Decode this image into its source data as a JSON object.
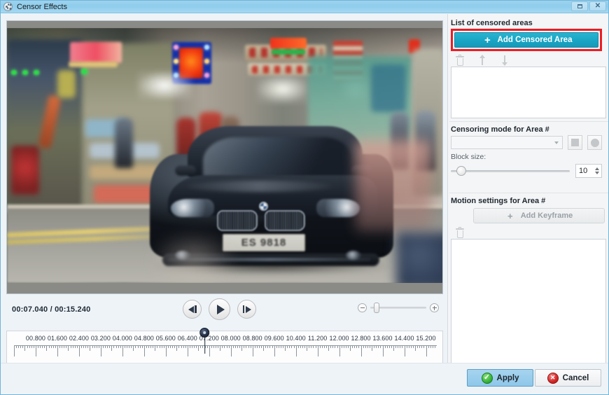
{
  "window": {
    "title": "Censor Effects",
    "icon": "film-reel-icon",
    "controls": [
      {
        "name": "restore-button",
        "glyph": "restore"
      },
      {
        "name": "close-button",
        "glyph": "close"
      }
    ]
  },
  "preview": {
    "license_plate": "ES 9818",
    "scene_description": "blurred city street with dark sedan"
  },
  "playback": {
    "current_time": "00:07.040",
    "separator": "/",
    "total_time": "00:15.240",
    "time_readout": "00:07.040 / 00:15.240",
    "prev_frame_label": "prev-frame",
    "play_label": "play",
    "next_frame_label": "next-frame",
    "zoom_out_label": "zoom-out",
    "zoom_in_label": "zoom-in",
    "zoom_value_pct": 6
  },
  "timeline": {
    "start": 0,
    "end": 15.6,
    "playhead_seconds": 7.04,
    "tick_labels": [
      "00.800",
      "01.600",
      "02.400",
      "03.200",
      "04.000",
      "04.800",
      "05.600",
      "06.400",
      "07.200",
      "08.000",
      "08.800",
      "09.600",
      "10.400",
      "11.200",
      "12.000",
      "12.800",
      "13.600",
      "14.400",
      "15.200"
    ],
    "tick_values": [
      0.8,
      1.6,
      2.4,
      3.2,
      4.0,
      4.8,
      5.6,
      6.4,
      7.2,
      8.0,
      8.8,
      9.6,
      10.4,
      11.2,
      12.0,
      12.8,
      13.6,
      14.4,
      15.2
    ]
  },
  "panel": {
    "areas_section": {
      "label": "List of censored areas",
      "add_button": "Add Censored Area",
      "add_button_plus": "+",
      "highlight_color": "#ec1c24",
      "accent_color": "#1aa6c6",
      "tools": [
        {
          "name": "delete-area-icon",
          "tooltip": "delete"
        },
        {
          "name": "move-area-up-icon",
          "tooltip": "move up"
        },
        {
          "name": "move-area-down-icon",
          "tooltip": "move down"
        }
      ]
    },
    "censoring_section": {
      "label": "Censoring mode for Area #",
      "mode_value": "",
      "mode_placeholder": "",
      "shape_buttons": [
        {
          "name": "square-shape-button",
          "shape": "square"
        },
        {
          "name": "circle-shape-button",
          "shape": "circle"
        }
      ],
      "block_size_label": "Block size:",
      "block_size_value": "10",
      "block_size_slider_pct": 9
    },
    "motion_section": {
      "label": "Motion settings for Area #",
      "add_keyframe_button": "Add Keyframe",
      "add_keyframe_plus": "+",
      "tools": [
        {
          "name": "delete-keyframe-icon",
          "tooltip": "delete"
        }
      ]
    }
  },
  "footer": {
    "apply_label": "Apply",
    "apply_icon": "green-check-icon",
    "apply_glyph": "✓",
    "cancel_label": "Cancel",
    "cancel_icon": "red-x-icon",
    "cancel_glyph": "✕"
  }
}
